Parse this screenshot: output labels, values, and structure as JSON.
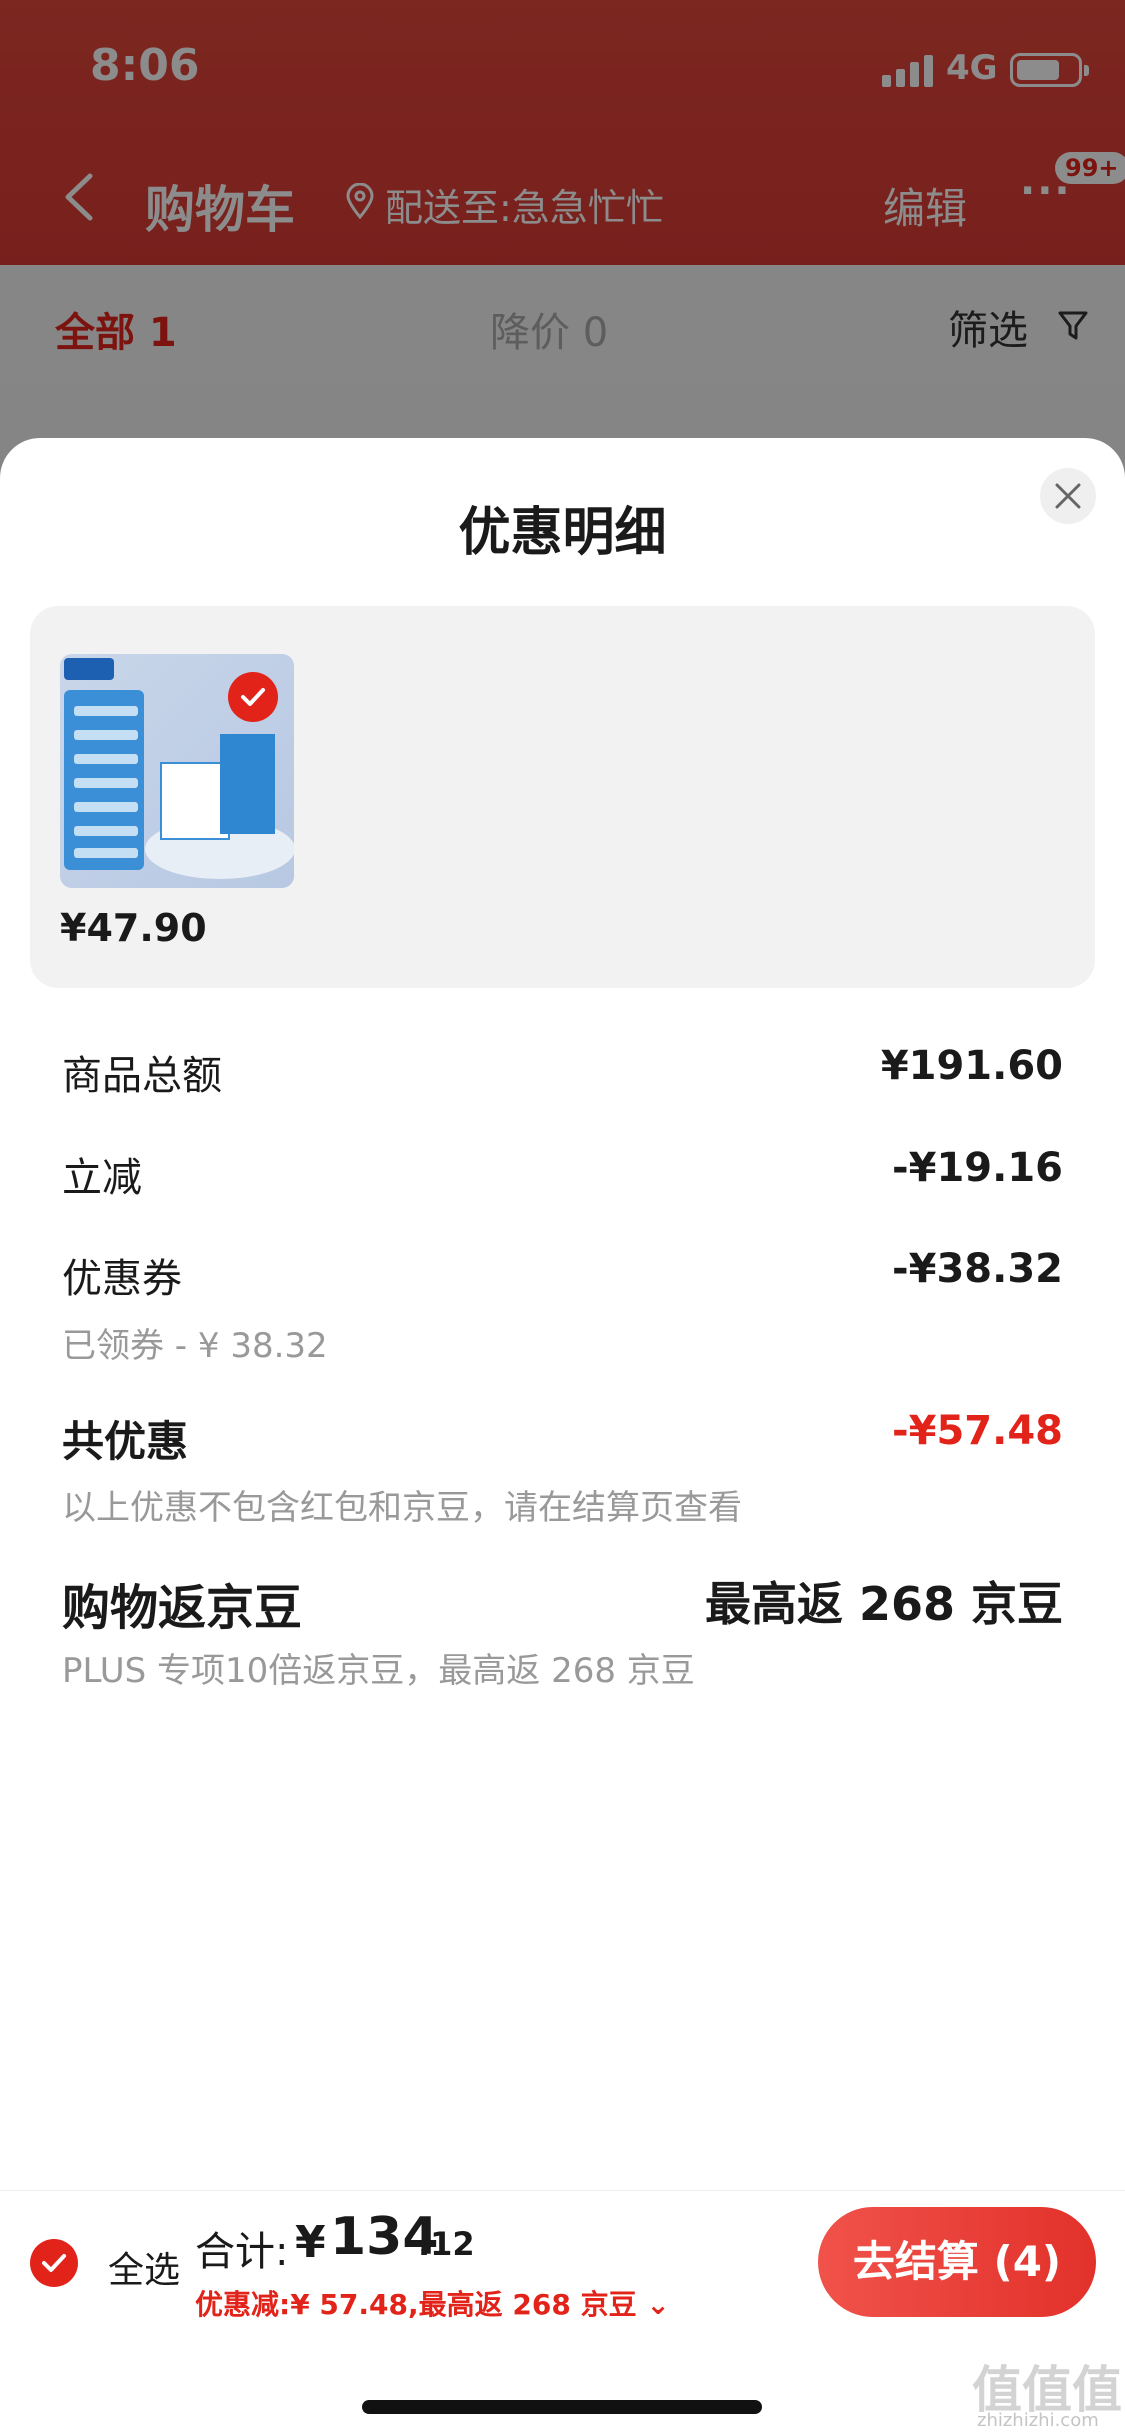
{
  "status_bar": {
    "time": "8:06",
    "network": "4G"
  },
  "nav": {
    "title": "购物车",
    "address": "配送至:急急忙忙",
    "edit": "编辑",
    "more": "···",
    "badge": "99+"
  },
  "tabs": {
    "all": "全部 1",
    "price_drop": "降价 0",
    "filter": "筛选"
  },
  "sheet": {
    "title": "优惠明细",
    "product": {
      "price": "¥47.90"
    },
    "rows": {
      "total": {
        "label": "商品总额",
        "value": "¥191.60"
      },
      "instant": {
        "label": "立减",
        "value": "-¥19.16"
      },
      "coupon": {
        "label": "优惠券",
        "value": "-¥38.32",
        "sub": "已领券 - ¥ 38.32"
      },
      "all_discount": {
        "label": "共优惠",
        "value": "-¥57.48",
        "sub": "以上优惠不包含红包和京豆，请在结算页查看"
      },
      "beans": {
        "label": "购物返京豆",
        "value": "最高返 268 京豆",
        "sub": "PLUS 专项10倍返京豆，最高返 268 京豆"
      }
    }
  },
  "bottom_bar": {
    "select_all": "全选",
    "total_label": "合计:",
    "currency": "¥",
    "total_int": "134",
    "total_dec": ".12",
    "discount_line": "优惠减:¥ 57.48,最高返 268 京豆 ⌄",
    "checkout": "去结算 (4)"
  },
  "watermark": {
    "main": "值值值",
    "sub": "zhizhizhi.com"
  },
  "colors": {
    "brand_red": "#e2231a",
    "header_red": "#e2473b"
  }
}
